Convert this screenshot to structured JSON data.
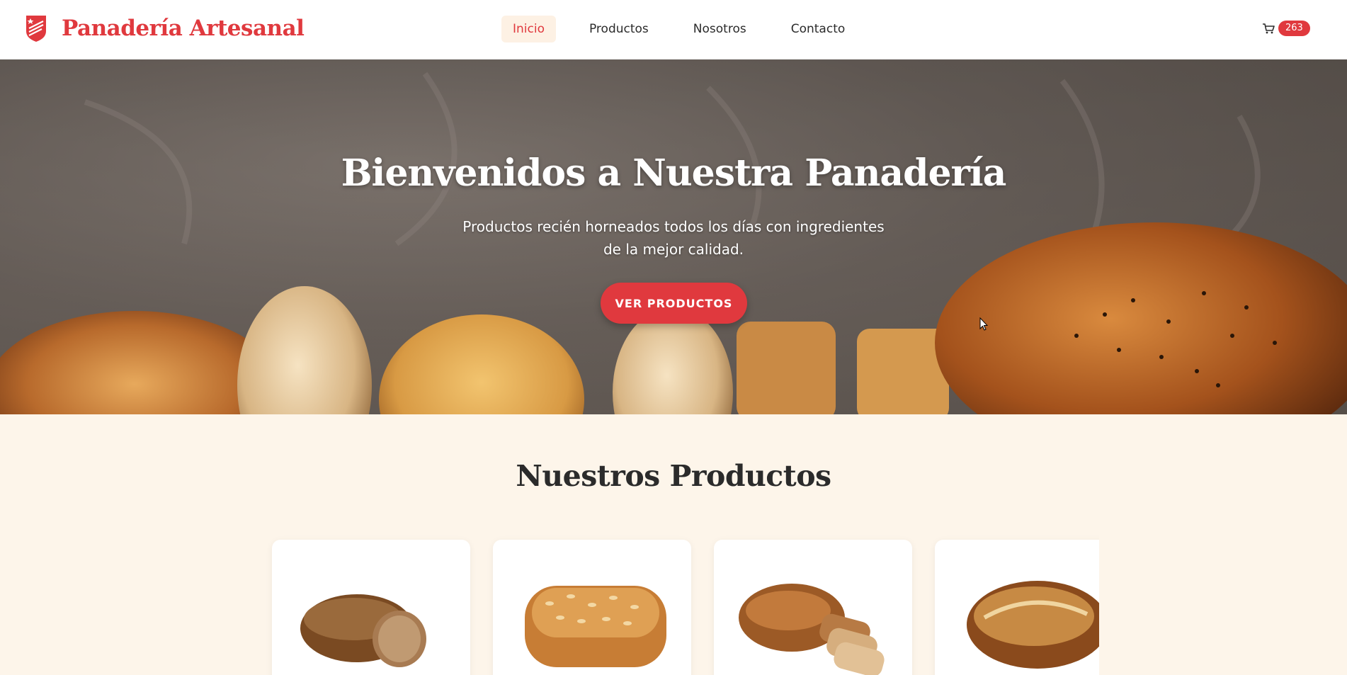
{
  "brand": {
    "name": "Panadería Artesanal",
    "logo_icon": "shield-logo-icon",
    "color": "#e0393e"
  },
  "nav": {
    "items": [
      {
        "label": "Inicio",
        "active": true
      },
      {
        "label": "Productos",
        "active": false
      },
      {
        "label": "Nosotros",
        "active": false
      },
      {
        "label": "Contacto",
        "active": false
      }
    ]
  },
  "cart": {
    "icon": "cart-icon",
    "count": "263"
  },
  "hero": {
    "title": "Bienvenidos a Nuestra Panadería",
    "subtitle": "Productos recién horneados todos los días con ingredientes de la mejor calidad.",
    "cta_label": "VER PRODUCTOS"
  },
  "products": {
    "title": "Nuestros Productos",
    "items": [
      {
        "image": "rye-bread-image"
      },
      {
        "image": "seeded-loaf-image"
      },
      {
        "image": "sliced-sourdough-image"
      },
      {
        "image": "country-loaf-image"
      }
    ]
  },
  "colors": {
    "accent": "#e0393e",
    "background": "#fdf5ea",
    "header": "#ffffff"
  }
}
